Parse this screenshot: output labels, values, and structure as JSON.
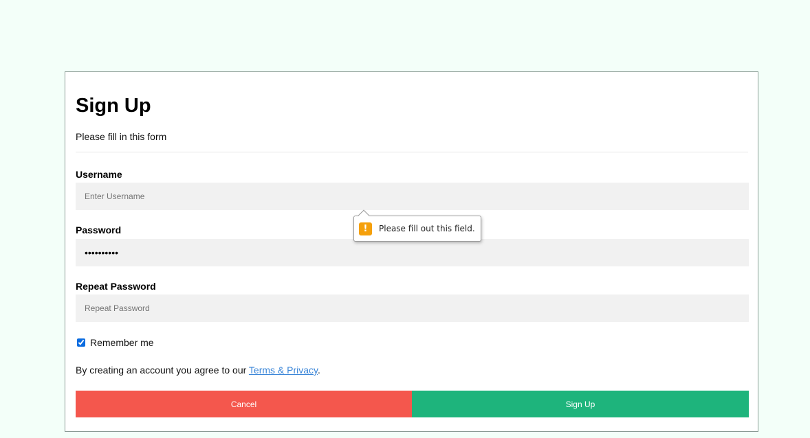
{
  "form": {
    "title": "Sign Up",
    "subtitle": "Please fill in this form",
    "username": {
      "label": "Username",
      "placeholder": "Enter Username",
      "value": ""
    },
    "password": {
      "label": "Password",
      "value": "••••••••••"
    },
    "repeat_password": {
      "label": "Repeat Password",
      "placeholder": "Repeat Password",
      "value": ""
    },
    "remember": {
      "label": "Remember me",
      "checked": true
    },
    "terms": {
      "prefix": "By creating an account you agree to our ",
      "link_text": "Terms & Privacy",
      "suffix": "."
    },
    "buttons": {
      "cancel_label": "Cancel",
      "signup_label": "Sign Up"
    }
  },
  "validation_tooltip": {
    "icon": "warning-icon",
    "icon_glyph": "!",
    "message": "Please fill out this field."
  },
  "colors": {
    "page_background": "#f3fff9",
    "cancel": "#f4574d",
    "signup": "#1eb47c",
    "link": "#3b86d8",
    "warning": "#f5a00b",
    "input_background": "#f1f1f1"
  }
}
